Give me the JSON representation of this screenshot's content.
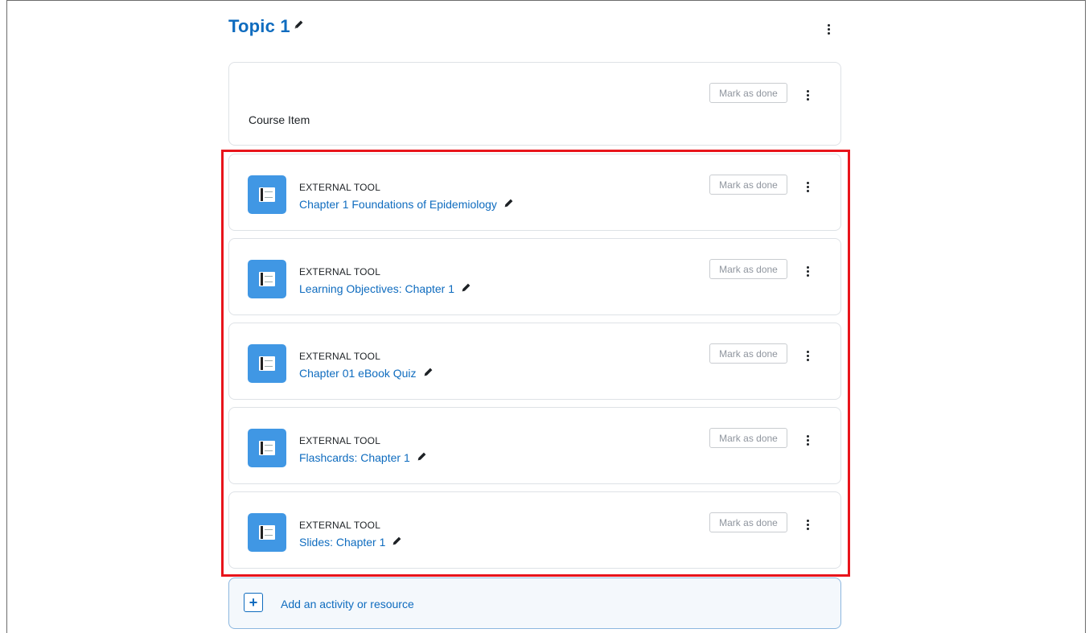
{
  "section": {
    "title": "Topic 1"
  },
  "course_item": {
    "label": "Course Item",
    "mark_done_label": "Mark as done"
  },
  "activities": [
    {
      "type": "EXTERNAL TOOL",
      "name": "Chapter 1 Foundations of Epidemiology",
      "mark_done_label": "Mark as done"
    },
    {
      "type": "EXTERNAL TOOL",
      "name": "Learning Objectives: Chapter 1",
      "mark_done_label": "Mark as done"
    },
    {
      "type": "EXTERNAL TOOL",
      "name": "Chapter 01 eBook Quiz",
      "mark_done_label": "Mark as done"
    },
    {
      "type": "EXTERNAL TOOL",
      "name": "Flashcards: Chapter 1",
      "mark_done_label": "Mark as done"
    },
    {
      "type": "EXTERNAL TOOL",
      "name": "Slides: Chapter 1",
      "mark_done_label": "Mark as done"
    }
  ],
  "add_activity": {
    "label": "Add an activity or resource"
  },
  "icons": {
    "edit": "pencil-icon",
    "menu": "kebab-menu-icon",
    "tool": "external-tool-icon",
    "add": "plus-icon"
  },
  "colors": {
    "link": "#0f6cbf",
    "tool_icon_bg": "#4097e4",
    "highlight": "#e8141b"
  }
}
